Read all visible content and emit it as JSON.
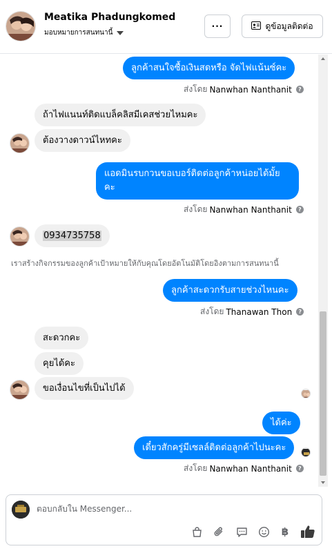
{
  "header": {
    "contact_name": "Meatika Phadungkomed",
    "assign_label": "มอบหมายการสนทนานี้",
    "more_label": "···",
    "contact_info_label": "ดูข้อมูลติดต่อ"
  },
  "messages": {
    "m1": "ลูกค้าสนใจซื้อเงินสดหรือ จัดไฟแน้นซ์คะ",
    "m1_sent_prefix": "ส่งโดย",
    "m1_sender": "Nanwhan Nanthanit",
    "m2": "ถ้าไฟแนนท์ติดแบล็คลิสมีเคสช่วยไหมคะ",
    "m3": "ต้องวางดาวน์ไหทคะ",
    "m4_line1": "แอดมินรบกวนขอเบอร์ติดต่อลูกค้าหน่อยได้มั้ย",
    "m4_line2": "คะ",
    "m4_sent_prefix": "ส่งโดย",
    "m4_sender": "Nanwhan Nanthanit",
    "m5": "0934735758",
    "system_note": "เราสร้างกิจกรรมของลูกค้าเป้าหมายให้กับคุณโดยอัตโนมัติโดยอิงตามการสนทนานี้",
    "m6": "ลูกค้าสะดวกรับสายช่วงไหนคะ",
    "m6_sent_prefix": "ส่งโดย",
    "m6_sender": "Thanawan Thon",
    "m7": "สะดวกคะ",
    "m8": "คุยได้คะ",
    "m9": "ขอเงื่อนไขที่เป็นไปได้",
    "m10": "ได้ค่ะ",
    "m11": "เดี๋ยวสักครู่มีเซลล์ติดต่อลูกค้าไปนะคะ",
    "m11_sent_prefix": "ส่งโดย",
    "m11_sender": "Nanwhan Nanthanit"
  },
  "composer": {
    "placeholder": "ตอบกลับใน Messenger..."
  },
  "icons": {
    "contact_card": "contact-card-icon",
    "shopping_bag": "shopping-bag-icon",
    "attachment": "paperclip-icon",
    "saved_reply": "speech-bubble-icon",
    "emoji": "smiley-icon",
    "payment": "baht-icon",
    "like": "thumbs-up-icon"
  },
  "colors": {
    "outgoing_bubble": "#0084ff",
    "incoming_bubble": "#f0f0f0",
    "muted_text": "#65676b"
  }
}
